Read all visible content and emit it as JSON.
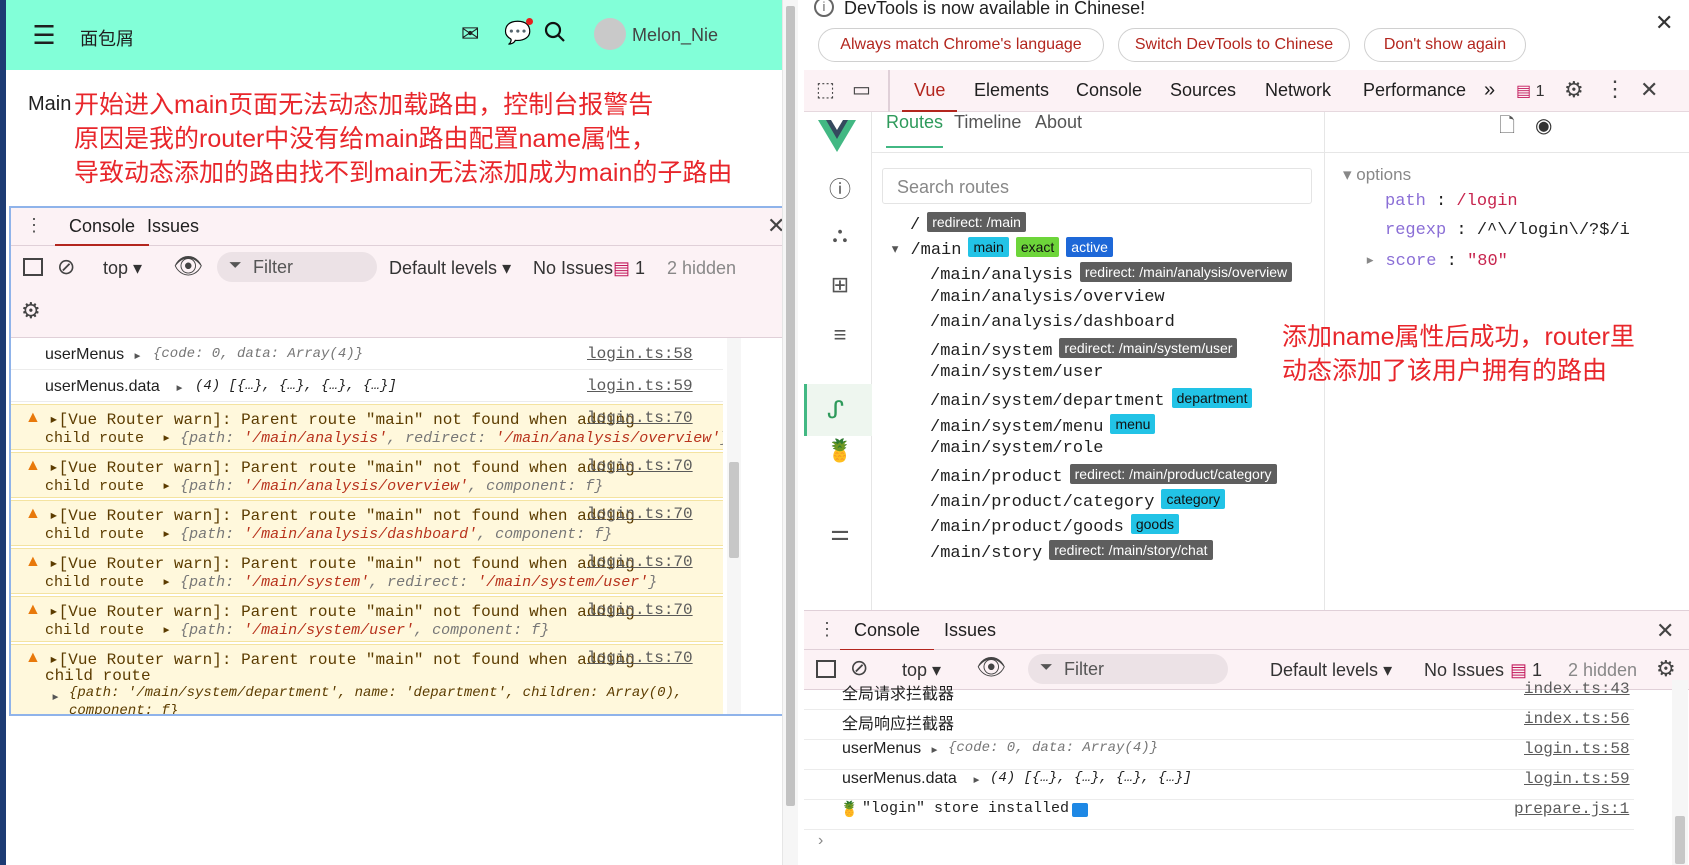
{
  "left_app": {
    "header": {
      "menu_icon": "menu-fold-icon",
      "title": "面包屑",
      "user_name": "Melon_Nie"
    },
    "main_label": "Main",
    "annotation_lines": [
      "开始进入main页面无法动态加载路由，控制台报警告",
      "原因是我的router中没有给main路由配置name属性，",
      "导致动态添加的路由找不到main无法添加成为main的子路由"
    ],
    "console": {
      "tabs": [
        "Console",
        "Issues"
      ],
      "toolbar": {
        "context": "top",
        "filter_placeholder": "Filter",
        "levels": "Default levels",
        "issues": "No Issues",
        "issue_count": "1",
        "hidden": "2 hidden"
      },
      "logs": [
        {
          "label": "userMenus",
          "obj": "{code: 0, data: Array(4)}",
          "src": "login.ts:58"
        },
        {
          "label": "userMenus.data",
          "obj": "(4)  [{…},  {…},  {…},  {…}]",
          "src": "login.ts:59"
        }
      ],
      "warn_prefix": "[Vue Router warn]: Parent route \"main\" not found when adding",
      "warn_child": "child route",
      "warnings": [
        {
          "src": "login.ts:70",
          "path": "'/main/analysis'",
          "k2": "redirect",
          "v2": "'/main/analysis/overview'"
        },
        {
          "src": "login.ts:70",
          "path": "'/main/analysis/overview'",
          "k2": "component",
          "v2": "f"
        },
        {
          "src": "login.ts:70",
          "path": "'/main/analysis/dashboard'",
          "k2": "component",
          "v2": "f"
        },
        {
          "src": "login.ts:70",
          "path": "'/main/system'",
          "k2": "redirect",
          "v2": "'/main/system/user'"
        },
        {
          "src": "login.ts:70",
          "path": "'/main/system/user'",
          "k2": "component",
          "v2": "f"
        }
      ],
      "last_warning": {
        "src": "login.ts:70",
        "detail": "{path: '/main/system/department', name: 'department', children: Array(0),",
        "cut": "component: f}"
      }
    }
  },
  "devtools": {
    "banner": {
      "text": "DevTools is now available in Chinese!",
      "buttons": [
        "Always match Chrome's language",
        "Switch DevTools to Chinese",
        "Don't show again"
      ]
    },
    "tabs": [
      "Vue",
      "Elements",
      "Console",
      "Sources",
      "Network",
      "Performance"
    ],
    "issue_count": "1",
    "vue": {
      "subtabs": [
        "Routes",
        "Timeline",
        "About"
      ],
      "search_placeholder": "Search routes",
      "routes": [
        {
          "path": "/",
          "badges": [
            {
              "t": "redirect: /main",
              "c": "gray"
            }
          ]
        },
        {
          "path": "/main",
          "badges": [
            {
              "t": "main",
              "c": "cyan"
            },
            {
              "t": "exact",
              "c": "green"
            },
            {
              "t": "active",
              "c": "blue"
            }
          ]
        },
        {
          "path": "/main/analysis",
          "badges": [
            {
              "t": "redirect: /main/analysis/overview",
              "c": "gray"
            }
          ]
        },
        {
          "path": "/main/analysis/overview",
          "badges": []
        },
        {
          "path": "/main/analysis/dashboard",
          "badges": []
        },
        {
          "path": "/main/system",
          "badges": [
            {
              "t": "redirect: /main/system/user",
              "c": "gray"
            }
          ]
        },
        {
          "path": "/main/system/user",
          "badges": []
        },
        {
          "path": "/main/system/department",
          "badges": [
            {
              "t": "department",
              "c": "cyan"
            }
          ]
        },
        {
          "path": "/main/system/menu",
          "badges": [
            {
              "t": "menu",
              "c": "cyan"
            }
          ]
        },
        {
          "path": "/main/system/role",
          "badges": []
        },
        {
          "path": "/main/product",
          "badges": [
            {
              "t": "redirect: /main/product/category",
              "c": "gray"
            }
          ]
        },
        {
          "path": "/main/product/category",
          "badges": [
            {
              "t": "category",
              "c": "cyan"
            }
          ]
        },
        {
          "path": "/main/product/goods",
          "badges": [
            {
              "t": "goods",
              "c": "cyan"
            }
          ]
        },
        {
          "path": "/main/story",
          "badges": [
            {
              "t": "redirect: /main/story/chat",
              "c": "gray"
            }
          ]
        }
      ],
      "options": {
        "label": "options",
        "path_key": "path",
        "path_val": "/login",
        "regexp_key": "regexp",
        "regexp_val": "/^\\/login\\/?$/i",
        "score_key": "score",
        "score_val": "\"80\""
      }
    },
    "annotation_lines": [
      "添加name属性后成功，router里",
      "动态添加了该用户拥有的路由"
    ],
    "console": {
      "tabs": [
        "Console",
        "Issues"
      ],
      "toolbar": {
        "context": "top",
        "filter_placeholder": "Filter",
        "levels": "Default levels",
        "issues": "No Issues",
        "issue_count": "1",
        "hidden": "2 hidden"
      },
      "logs": [
        {
          "label": "全局请求拦截器",
          "obj": "",
          "src": "index.ts:43"
        },
        {
          "label": "全局响应拦截器",
          "obj": "",
          "src": "index.ts:56"
        },
        {
          "label": "userMenus",
          "obj": "{code: 0, data: Array(4)}",
          "src": "login.ts:58"
        },
        {
          "label": "userMenus.data",
          "obj": "(4)  [{…},  {…},  {…},  {…}]",
          "src": "login.ts:59"
        },
        {
          "label": "\"login\" store installed",
          "obj": "",
          "src": "prepare.js:1"
        }
      ]
    }
  }
}
